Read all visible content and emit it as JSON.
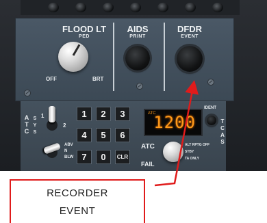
{
  "panel": {
    "flood_lt": "FLOOD LT",
    "ped": "PED",
    "off": "OFF",
    "brt": "BRT",
    "aids": "AIDS",
    "print": "PRINT",
    "dfdr": "DFDR",
    "event": "EVENT"
  },
  "transponder": {
    "atc_side": "ATC",
    "sys": "SYS",
    "sys1": "1",
    "sys2": "2",
    "keys": [
      "1",
      "2",
      "3",
      "4",
      "5",
      "6",
      "7",
      "0",
      "CLR"
    ],
    "code": "1200",
    "atc": "ATC",
    "fail": "FAIL",
    "ident": "IDENT",
    "tcas": "TCAS",
    "mode_options": [
      "ABV",
      "N",
      "BLW"
    ],
    "alt_rptg_off": "ALT RPTG OFF",
    "stby": "STBY",
    "ta_only": "TA ONLY"
  },
  "callout": {
    "line1": "RECORDER",
    "line2": "EVENT"
  },
  "colors": {
    "callout_border": "#e01b1b",
    "arrow": "#e01b1b",
    "lcd_digits": "#ff9a1a",
    "panel": "#45525e"
  }
}
